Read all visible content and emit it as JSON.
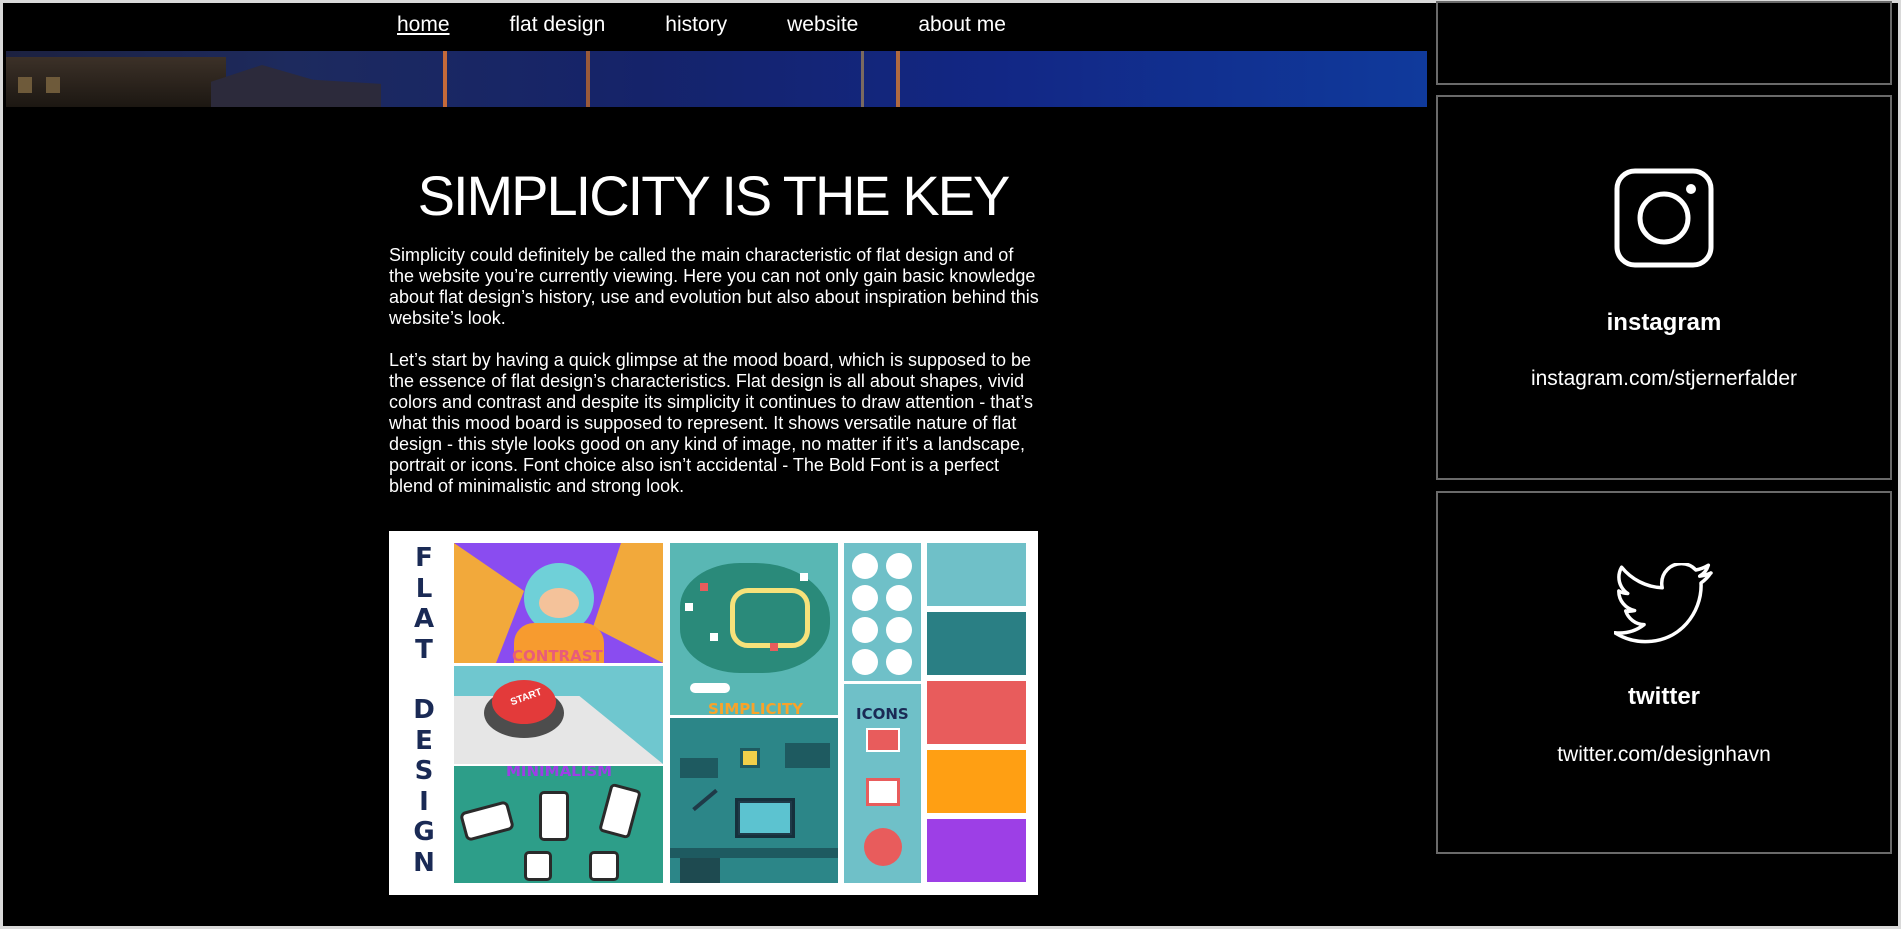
{
  "nav": {
    "items": [
      {
        "label": "home",
        "active": true
      },
      {
        "label": "flat design",
        "active": false
      },
      {
        "label": "history",
        "active": false
      },
      {
        "label": "website",
        "active": false
      },
      {
        "label": "about me",
        "active": false
      }
    ]
  },
  "main": {
    "title": "SIMPLICITY IS THE KEY",
    "paragraph1": "Simplicity could definitely be called the main characteristic of flat design and of the website you’re currently viewing. Here you can not only gain basic knowledge about flat design’s history, use and evolution but also about inspiration behind this website’s look.",
    "paragraph2": "Let’s start by having a quick glimpse at the mood board, which is supposed to be the essence of flat design’s characteristics. Flat design is all about shapes, vivid colors and contrast and despite its simplicity it continues to draw attention - that’s what this mood board is supposed to represent. It shows versatile nature of flat design - this style looks good on any kind of image, no matter if it’s a landscape, portrait or icons. Font choice also isn’t accidental - The Bold Font is a perfect blend of minimalistic and strong look."
  },
  "moodboard": {
    "letters": [
      "F",
      "L",
      "A",
      "T",
      "",
      "D",
      "E",
      "S",
      "I",
      "G",
      "N"
    ],
    "labels": {
      "contrast": "CONTRAST",
      "minimalism": "MINIMALISM",
      "simplicity": "SIMPLICITY",
      "icons": "ICONS",
      "start": "START"
    },
    "swatches": [
      "#6fc0c8",
      "#2a7f84",
      "#e85c5c",
      "#ff9f13",
      "#9d3fe6"
    ]
  },
  "sidebar": {
    "instagram": {
      "name": "instagram",
      "url": "instagram.com/stjernerfalder",
      "icon": "instagram-icon"
    },
    "twitter": {
      "name": "twitter",
      "url": "twitter.com/designhavn",
      "icon": "twitter-icon"
    }
  }
}
